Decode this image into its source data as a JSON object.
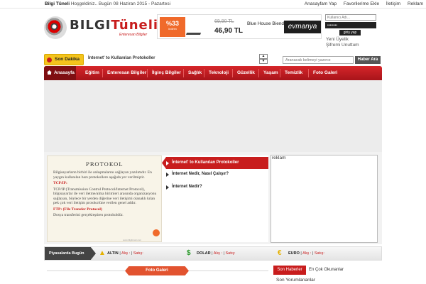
{
  "topbar": {
    "site_name": "Bilgi Tüneli",
    "greeting": "Hoşgeldiniz.. Bugün 08 Haziran 2015 - Pazartesi",
    "links": [
      "Anasayfam Yap",
      "Favorilerime Ekle",
      "İletişim",
      "Reklam"
    ]
  },
  "logo": {
    "word_left": "BILGI",
    "word_right": "Tüneli",
    "slogan": "Enteresan Bilgiler"
  },
  "ad_banner": {
    "discount": "%33",
    "discount_note": "indirim",
    "old_price": "69,90 TL",
    "new_price": "46,90 TL",
    "product": "Blue House Biender",
    "brand": "evmanya"
  },
  "login": {
    "username_placeholder": "Kullanıcı Adı...",
    "password_value": "••••••••",
    "submit_label": "giriş yap",
    "register_link": "Yeni Üyelik",
    "forgot_link": "Şifremi Unuttum"
  },
  "breaking": {
    "label": "Son Dakika",
    "headline": "İnternet' to Kullanılan Protokoller",
    "search_placeholder": "Aranacak kelimeyi yazınız",
    "search_button": "Haber Ara"
  },
  "nav": {
    "home": "Anasayfa",
    "items": [
      "Eğitim",
      "Enteresan Bilgiler",
      "İlginç Bilgiler",
      "Sağlık",
      "Teknoloji",
      "Güzellik",
      "Yaşam",
      "Temizlik",
      "Foto Galeri"
    ]
  },
  "featured": {
    "title": "PROTOKOL",
    "intro": "Bilgisayarların birbiri ile anlaşmalarını sağlayan yazılımdır. En yaygın kullanılan bazı protokollere aşağıda yer verilmiştir.",
    "tcp_label": "TCP/IP:",
    "tcp_text": "TCP/IP (Transmission Control Protocol/Internet Protocol), bilgisayarlar ile veri iletme/alma birimleri arasında organizasyonu sağlayan, böylece bir yerden diğerine veri iletişimi olanaklı kılan pek çok veri iletişim protokolüne verilen genel addır.",
    "ftp_label": "FTP: (File Transfer Protocol)",
    "ftp_text": "Dosya transferini gerçekleştiren protokoldür.",
    "credit": "www.bilgitüneli.com"
  },
  "news_list": [
    "İnternet' to Kullanılan Protokoller",
    "İnternet Nedir, Nasıl Çalışır?",
    "İnternet Nedir?"
  ],
  "right_ad": {
    "label": "reklam"
  },
  "markets": {
    "title": "Piyasalarda Bugün",
    "items": [
      {
        "name": "ALTIN",
        "buy": "Alış :",
        "sell": "Satış:"
      },
      {
        "name": "DOLAR",
        "buy": "Alış :",
        "sell": "Satış:"
      },
      {
        "name": "EURO",
        "buy": "Alış :",
        "sell": "Satış:"
      }
    ]
  },
  "photo_gallery": {
    "title": "Foto Galeri"
  },
  "news_tabs": {
    "tab1": "Son Haberler",
    "tab2": "En Çok Okunanlar",
    "sub": "Son Yorumlananlar"
  }
}
